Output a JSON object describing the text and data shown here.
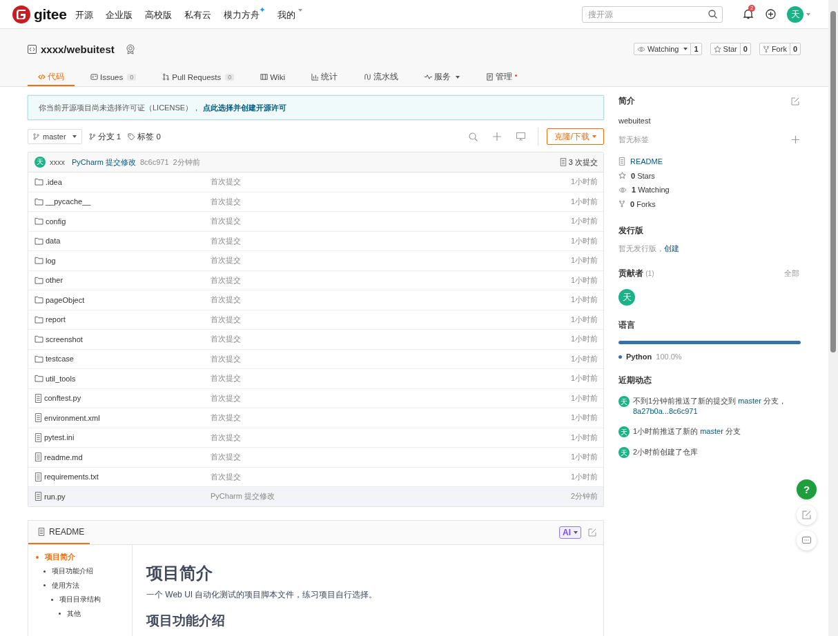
{
  "topnav": {
    "logo": "gitee",
    "items": [
      {
        "label": "开源",
        "new": false
      },
      {
        "label": "企业版",
        "new": false
      },
      {
        "label": "高校版",
        "new": false
      },
      {
        "label": "私有云",
        "new": false
      },
      {
        "label": "模力方舟",
        "new": true
      }
    ],
    "mine": "我的",
    "search": {
      "placeholder": "搜开源"
    },
    "notifications": "2",
    "avatar": "天"
  },
  "repo": {
    "name": "xxxx/webuitest",
    "actions": [
      {
        "kind": "watch",
        "label": "Watching",
        "count": "1"
      },
      {
        "kind": "star",
        "label": "Star",
        "count": "0"
      },
      {
        "kind": "fork",
        "label": "Fork",
        "count": "0"
      }
    ]
  },
  "tabs": [
    {
      "kind": "code",
      "label": "代码",
      "selected": true,
      "dot": false,
      "caret": false
    },
    {
      "kind": "issues",
      "label": "Issues",
      "count": "0",
      "selected": false,
      "dot": false,
      "caret": false
    },
    {
      "kind": "pr",
      "label": "Pull Requests",
      "count": "0",
      "selected": false,
      "dot": false,
      "caret": false
    },
    {
      "kind": "wiki",
      "label": "Wiki",
      "selected": false,
      "dot": false,
      "caret": false
    },
    {
      "kind": "stats",
      "label": "统计",
      "selected": false,
      "dot": false,
      "caret": false
    },
    {
      "kind": "pipeline",
      "label": "流水线",
      "selected": false,
      "dot": false,
      "caret": false
    },
    {
      "kind": "service",
      "label": "服务",
      "selected": false,
      "dot": false,
      "caret": true
    },
    {
      "kind": "manage",
      "label": "管理",
      "selected": false,
      "dot": true,
      "caret": false
    }
  ],
  "notice": {
    "text": "你当前开源项目尚未选择许可证（LICENSE），",
    "link": "点此选择并创建开源许可"
  },
  "toolbar": {
    "branch": "master",
    "branches": "分支 1",
    "tags": "标签 0",
    "clone": "克隆/下载"
  },
  "last_commit": {
    "avatar": "天",
    "author": "xxxx",
    "message": "PyCharm 提交修改",
    "hash": "8c6c971",
    "time": "2分钟前",
    "commits": "3 次提交"
  },
  "files": [
    {
      "kind": "folder",
      "name": ".idea",
      "message": "首次提交",
      "time": "1小时前",
      "selected": false
    },
    {
      "kind": "folder",
      "name": "__pycache__",
      "message": "首次提交",
      "time": "1小时前",
      "selected": false
    },
    {
      "kind": "folder",
      "name": "config",
      "message": "首次提交",
      "time": "1小时前",
      "selected": false
    },
    {
      "kind": "folder",
      "name": "data",
      "message": "首次提交",
      "time": "1小时前",
      "selected": false
    },
    {
      "kind": "folder",
      "name": "log",
      "message": "首次提交",
      "time": "1小时前",
      "selected": false
    },
    {
      "kind": "folder",
      "name": "other",
      "message": "首次提交",
      "time": "1小时前",
      "selected": false
    },
    {
      "kind": "folder",
      "name": "pageObject",
      "message": "首次提交",
      "time": "1小时前",
      "selected": false
    },
    {
      "kind": "folder",
      "name": "report",
      "message": "首次提交",
      "time": "1小时前",
      "selected": false
    },
    {
      "kind": "folder",
      "name": "screenshot",
      "message": "首次提交",
      "time": "1小时前",
      "selected": false
    },
    {
      "kind": "folder",
      "name": "testcase",
      "message": "首次提交",
      "time": "1小时前",
      "selected": false
    },
    {
      "kind": "folder",
      "name": "util_tools",
      "message": "首次提交",
      "time": "1小时前",
      "selected": false
    },
    {
      "kind": "file",
      "name": "conftest.py",
      "message": "首次提交",
      "time": "1小时前",
      "selected": false
    },
    {
      "kind": "file",
      "name": "environment.xml",
      "message": "首次提交",
      "time": "1小时前",
      "selected": false
    },
    {
      "kind": "file",
      "name": "pytest.ini",
      "message": "首次提交",
      "time": "1小时前",
      "selected": false
    },
    {
      "kind": "file",
      "name": "readme.md",
      "message": "首次提交",
      "time": "1小时前",
      "selected": false
    },
    {
      "kind": "file",
      "name": "requirements.txt",
      "message": "首次提交",
      "time": "1小时前",
      "selected": false
    },
    {
      "kind": "file",
      "name": "run.py",
      "message": "PyCharm 提交修改",
      "time": "2分钟前",
      "selected": true
    }
  ],
  "readme": {
    "tab": "README",
    "ai": "AI",
    "toc": [
      {
        "label": "项目简介",
        "selected": true,
        "children": [
          {
            "label": "项目功能介绍",
            "selected": false
          },
          {
            "label": "使用方法",
            "selected": false,
            "children": [
              {
                "label": "项目目录结构",
                "selected": false,
                "children": [
                  {
                    "label": "其他",
                    "selected": false
                  }
                ]
              }
            ]
          }
        ]
      }
    ],
    "title": "项目简介",
    "intro": "一个 Web UI 自动化测试的项目脚本文件，练习项目自行选择。",
    "subtitle": "项目功能介绍"
  },
  "sidebar": {
    "about": {
      "title": "简介",
      "description": "webuitest",
      "no_tags": "暂无标签",
      "links": [
        {
          "kind": "readme",
          "label": "README"
        },
        {
          "kind": "star",
          "count": "0",
          "label": "Stars"
        },
        {
          "kind": "watch",
          "count": "1",
          "label": "Watching"
        },
        {
          "kind": "fork",
          "count": "0",
          "label": "Forks"
        }
      ]
    },
    "releases": {
      "title": "发行版",
      "text": "暂无发行版，",
      "link": "创建"
    },
    "contributors": {
      "title": "贡献者",
      "count": "(1)",
      "all": "全部",
      "avatars": [
        "天"
      ]
    },
    "languages": {
      "title": "语言",
      "items": [
        {
          "name": "Python",
          "percent": "100.0%",
          "level": 1,
          "color": "#3572a5"
        }
      ]
    },
    "activity": {
      "title": "近期动态",
      "items": [
        {
          "avatar": "天",
          "parts": [
            {
              "kind": "text",
              "text": "不到1分钟前推送了新的提交到 "
            },
            {
              "kind": "link",
              "text": "master"
            },
            {
              "kind": "text",
              "text": " 分支，"
            },
            {
              "kind": "link",
              "text": "8a27b0a...8c6c971"
            }
          ]
        },
        {
          "avatar": "天",
          "parts": [
            {
              "kind": "text",
              "text": "1小时前推送了新的 "
            },
            {
              "kind": "link",
              "text": "master"
            },
            {
              "kind": "text",
              "text": " 分支"
            }
          ]
        },
        {
          "avatar": "天",
          "parts": [
            {
              "kind": "text",
              "text": "2小时前创建了仓库"
            }
          ]
        }
      ]
    }
  },
  "float_buttons": [
    {
      "kind": "help",
      "label": "?"
    },
    {
      "kind": "edit"
    },
    {
      "kind": "chat"
    }
  ]
}
